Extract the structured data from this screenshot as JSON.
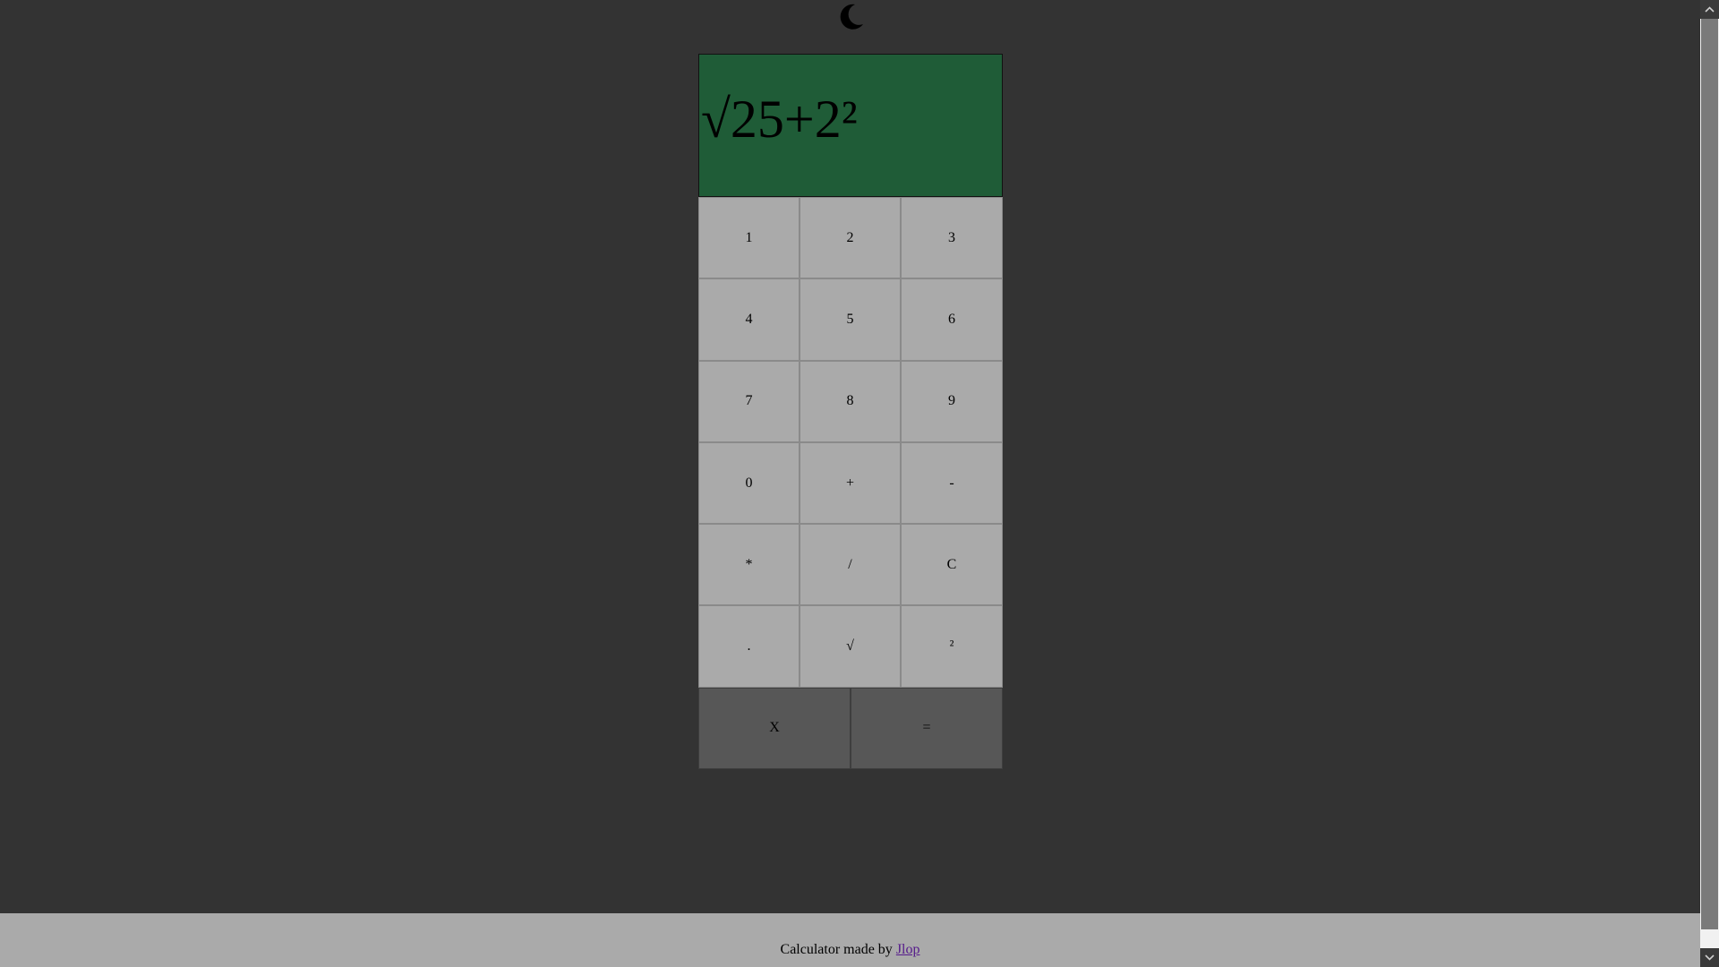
{
  "display": {
    "expression": "√25+2²"
  },
  "keypad": {
    "keys": [
      "1",
      "2",
      "3",
      "4",
      "5",
      "6",
      "7",
      "8",
      "9",
      "0",
      "+",
      "-",
      "*",
      "/",
      "C",
      ".",
      "√",
      "²"
    ],
    "bottom": [
      "X",
      "="
    ]
  },
  "footer": {
    "text": "Calculator made by ",
    "link": "Jlop"
  },
  "icons": {
    "theme_toggle": "moon-icon"
  },
  "colors": {
    "page_background": "#333333",
    "display_background": "#1f5c37",
    "key_background": "#aaaaaa",
    "bottom_key_background": "#575757",
    "footer_background": "#aaaaaa",
    "link": "#551a8b"
  }
}
